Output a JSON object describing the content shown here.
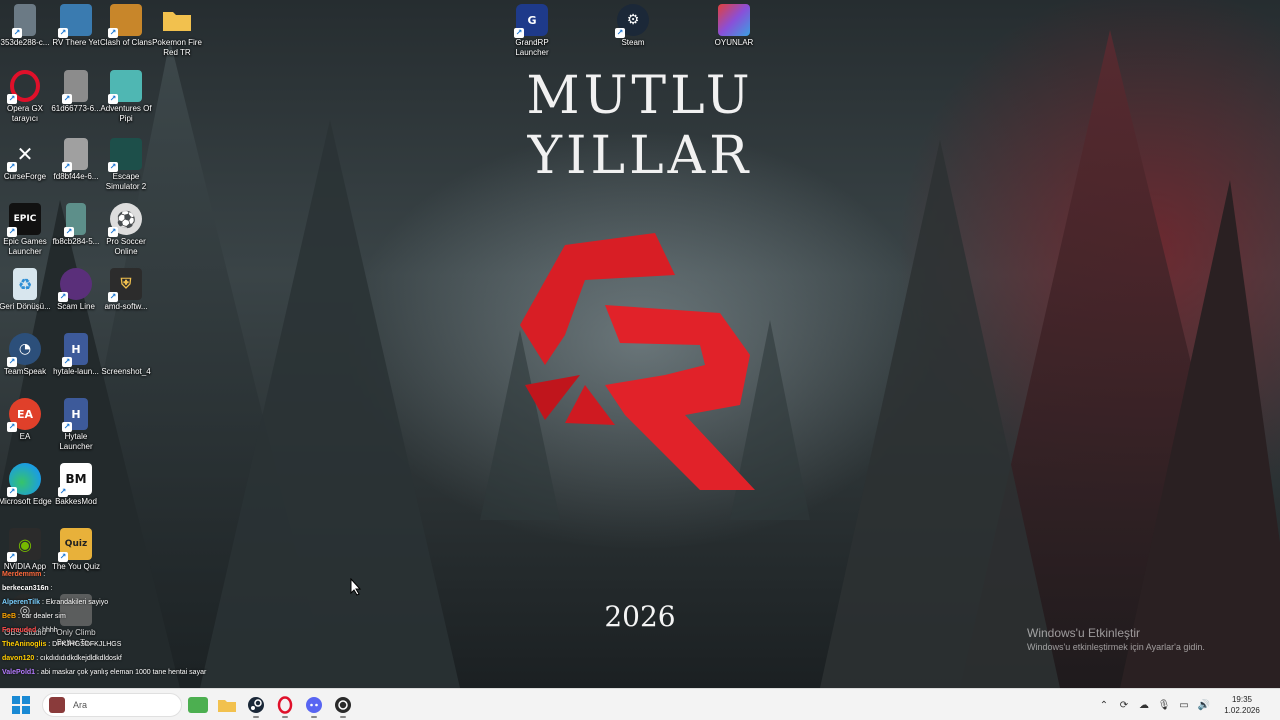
{
  "wallpaper": {
    "title": "MUTLU YILLAR",
    "year": "2026"
  },
  "desktop": {
    "icons": [
      {
        "label": "353de288-c...",
        "icon": "image-file-icon",
        "color": "#6b7a85"
      },
      {
        "label": "RV There Yet",
        "icon": "game-icon",
        "color": "#3a7bb0"
      },
      {
        "label": "Clash of Clans",
        "icon": "game-icon",
        "color": "#c8862a"
      },
      {
        "label": "Pokemon Fire Red TR",
        "icon": "folder-icon",
        "color": "#f2c14e"
      },
      {
        "label": "Opera GX tarayıcı",
        "icon": "opera-icon",
        "color": "#b0102a"
      },
      {
        "label": "61d66773-6...",
        "icon": "image-file-icon",
        "color": "#8c8c8c"
      },
      {
        "label": "Adventures Of Pipi",
        "icon": "game-icon",
        "color": "#4fb7b3"
      },
      {
        "label": "CurseForge",
        "icon": "curseforge-icon",
        "color": "#222222"
      },
      {
        "label": "fd8bf44e-6...",
        "icon": "image-file-icon",
        "color": "#a0a0a0"
      },
      {
        "label": "Escape Simulator 2",
        "icon": "game-icon",
        "color": "#1d4f4a"
      },
      {
        "label": "Epic Games Launcher",
        "icon": "epic-icon",
        "color": "#111111"
      },
      {
        "label": "fb8cb284-5...",
        "icon": "image-file-icon",
        "color": "#5d8f8a"
      },
      {
        "label": "Pro Soccer Online",
        "icon": "soccer-icon",
        "color": "#dddddd"
      },
      {
        "label": "Geri Dönüşü...",
        "icon": "recycle-bin-icon",
        "color": "#d8e6ee"
      },
      {
        "label": "Scam Line",
        "icon": "game-icon",
        "color": "#5a2f7a"
      },
      {
        "label": "amd-softw...",
        "icon": "installer-icon",
        "color": "#2c2c2c"
      },
      {
        "label": "TeamSpeak",
        "icon": "teamspeak-icon",
        "color": "#2c4f7a"
      },
      {
        "label": "hytale-laun...",
        "icon": "hytale-icon",
        "color": "#3d5a9a"
      },
      {
        "label": "Screenshot_4",
        "icon": "image-file-icon",
        "color": "#00000000"
      },
      {
        "label": "EA",
        "icon": "ea-icon",
        "color": "#e0402a"
      },
      {
        "label": "Hytale Launcher",
        "icon": "hytale-icon",
        "color": "#3d5a9a"
      },
      {
        "label": "Microsoft Edge",
        "icon": "edge-icon",
        "color": "#1b9de2"
      },
      {
        "label": "BakkesMod",
        "icon": "bakkesmod-icon",
        "color": "#ffffff"
      },
      {
        "label": "NVIDIA App",
        "icon": "nvidia-icon",
        "color": "#2b2b2b"
      },
      {
        "label": "The You Quiz",
        "icon": "quiz-icon",
        "color": "#e8b13a"
      },
      {
        "label": "OBS Studio",
        "icon": "obs-icon",
        "color": "#2a2a2a"
      },
      {
        "label": "Only Climb Better To...",
        "icon": "game-icon",
        "color": "#6a6a6a"
      },
      {
        "label": "GrandRP Launcher",
        "icon": "grandrp-icon",
        "color": "#1e3a8a"
      },
      {
        "label": "Steam",
        "icon": "steam-icon",
        "color": "#1b2838"
      },
      {
        "label": "OYUNLAR",
        "icon": "folder-icon",
        "color": "#8a4fd8"
      }
    ]
  },
  "chat": [
    {
      "user": "Merdemmm",
      "msg": ":",
      "color": "#ff6a3d"
    },
    {
      "user": "berkecan316n",
      "msg": ":",
      "color": "#ffffff"
    },
    {
      "user": "AlperenTilk",
      "msg": ": Ekrandakileri sayiyo",
      "color": "#7ad0ff"
    },
    {
      "user": "BeB",
      "msg": ": car dealer sim",
      "color": "#ffa500"
    },
    {
      "user": "Formuded",
      "msg": ": hhhh",
      "color": "#ff4a4a"
    },
    {
      "user": "TheAninoglis",
      "msg": ": DFKJHGSDFKJLHGS",
      "color": "#ffcc00"
    },
    {
      "user": "davon120",
      "msg": ": cıkdıdıdıdkdkejdldkdldoskf",
      "color": "#ffcc00"
    },
    {
      "user": "ValePold1",
      "msg": ": abi maskar çok yanlış eleman 1000 tane hentai sayar",
      "color": "#b57aff"
    }
  ],
  "activation": {
    "title": "Windows'u Etkinleştir",
    "subtitle": "Windows'u etkinleştirmek için Ayarlar'a gidin."
  },
  "taskbar": {
    "search_placeholder": "Ara",
    "pinned": [
      {
        "name": "widgets",
        "icon": "widgets-icon"
      },
      {
        "name": "file-explorer",
        "icon": "folder-icon"
      },
      {
        "name": "steam",
        "icon": "steam-icon"
      },
      {
        "name": "opera-gx",
        "icon": "opera-icon"
      },
      {
        "name": "discord",
        "icon": "discord-icon"
      },
      {
        "name": "obs",
        "icon": "obs-icon"
      }
    ],
    "clock_time": "19:35",
    "clock_date": "1.02.2026"
  }
}
